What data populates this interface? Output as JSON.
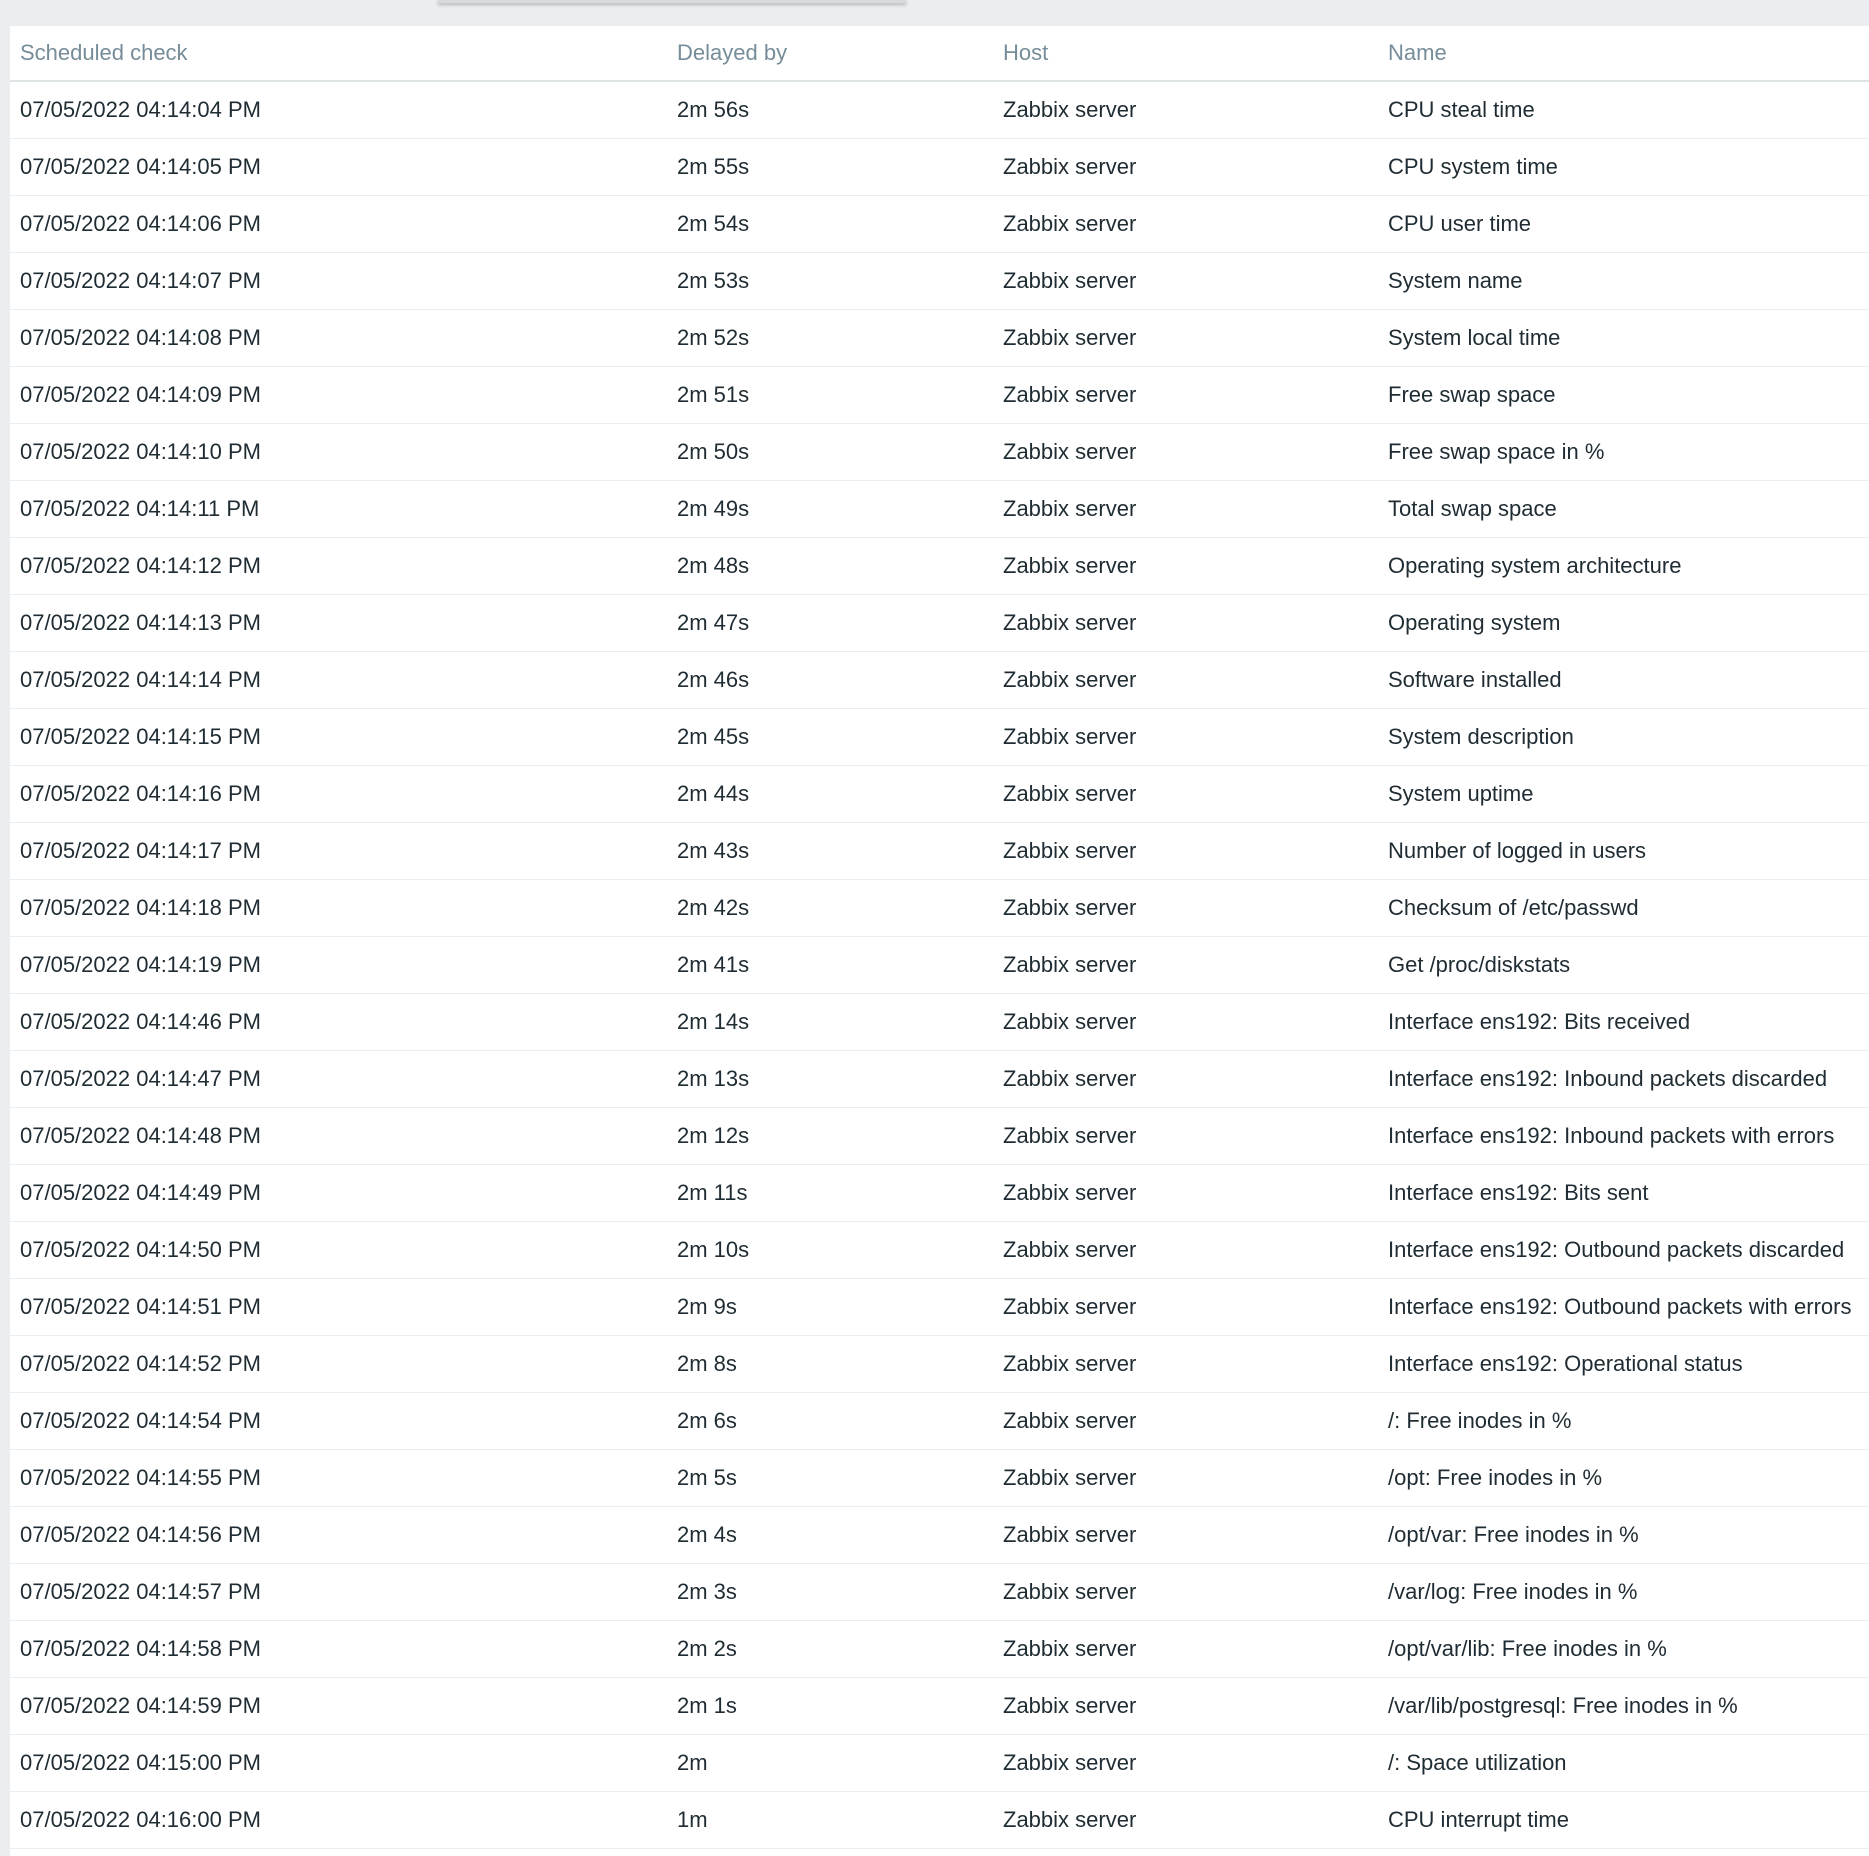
{
  "table": {
    "columns": [
      "Scheduled check",
      "Delayed by",
      "Host",
      "Name"
    ],
    "rows": [
      [
        "07/05/2022 04:14:04 PM",
        "2m 56s",
        "Zabbix server",
        "CPU steal time"
      ],
      [
        "07/05/2022 04:14:05 PM",
        "2m 55s",
        "Zabbix server",
        "CPU system time"
      ],
      [
        "07/05/2022 04:14:06 PM",
        "2m 54s",
        "Zabbix server",
        "CPU user time"
      ],
      [
        "07/05/2022 04:14:07 PM",
        "2m 53s",
        "Zabbix server",
        "System name"
      ],
      [
        "07/05/2022 04:14:08 PM",
        "2m 52s",
        "Zabbix server",
        "System local time"
      ],
      [
        "07/05/2022 04:14:09 PM",
        "2m 51s",
        "Zabbix server",
        "Free swap space"
      ],
      [
        "07/05/2022 04:14:10 PM",
        "2m 50s",
        "Zabbix server",
        "Free swap space in %"
      ],
      [
        "07/05/2022 04:14:11 PM",
        "2m 49s",
        "Zabbix server",
        "Total swap space"
      ],
      [
        "07/05/2022 04:14:12 PM",
        "2m 48s",
        "Zabbix server",
        "Operating system architecture"
      ],
      [
        "07/05/2022 04:14:13 PM",
        "2m 47s",
        "Zabbix server",
        "Operating system"
      ],
      [
        "07/05/2022 04:14:14 PM",
        "2m 46s",
        "Zabbix server",
        "Software installed"
      ],
      [
        "07/05/2022 04:14:15 PM",
        "2m 45s",
        "Zabbix server",
        "System description"
      ],
      [
        "07/05/2022 04:14:16 PM",
        "2m 44s",
        "Zabbix server",
        "System uptime"
      ],
      [
        "07/05/2022 04:14:17 PM",
        "2m 43s",
        "Zabbix server",
        "Number of logged in users"
      ],
      [
        "07/05/2022 04:14:18 PM",
        "2m 42s",
        "Zabbix server",
        "Checksum of /etc/passwd"
      ],
      [
        "07/05/2022 04:14:19 PM",
        "2m 41s",
        "Zabbix server",
        "Get /proc/diskstats"
      ],
      [
        "07/05/2022 04:14:46 PM",
        "2m 14s",
        "Zabbix server",
        "Interface ens192: Bits received"
      ],
      [
        "07/05/2022 04:14:47 PM",
        "2m 13s",
        "Zabbix server",
        "Interface ens192: Inbound packets discarded"
      ],
      [
        "07/05/2022 04:14:48 PM",
        "2m 12s",
        "Zabbix server",
        "Interface ens192: Inbound packets with errors"
      ],
      [
        "07/05/2022 04:14:49 PM",
        "2m 11s",
        "Zabbix server",
        "Interface ens192: Bits sent"
      ],
      [
        "07/05/2022 04:14:50 PM",
        "2m 10s",
        "Zabbix server",
        "Interface ens192: Outbound packets discarded"
      ],
      [
        "07/05/2022 04:14:51 PM",
        "2m 9s",
        "Zabbix server",
        "Interface ens192: Outbound packets with errors"
      ],
      [
        "07/05/2022 04:14:52 PM",
        "2m 8s",
        "Zabbix server",
        "Interface ens192: Operational status"
      ],
      [
        "07/05/2022 04:14:54 PM",
        "2m 6s",
        "Zabbix server",
        "/: Free inodes in %"
      ],
      [
        "07/05/2022 04:14:55 PM",
        "2m 5s",
        "Zabbix server",
        "/opt: Free inodes in %"
      ],
      [
        "07/05/2022 04:14:56 PM",
        "2m 4s",
        "Zabbix server",
        "/opt/var: Free inodes in %"
      ],
      [
        "07/05/2022 04:14:57 PM",
        "2m 3s",
        "Zabbix server",
        "/var/log: Free inodes in %"
      ],
      [
        "07/05/2022 04:14:58 PM",
        "2m 2s",
        "Zabbix server",
        "/opt/var/lib: Free inodes in %"
      ],
      [
        "07/05/2022 04:14:59 PM",
        "2m 1s",
        "Zabbix server",
        "/var/lib/postgresql: Free inodes in %"
      ],
      [
        "07/05/2022 04:15:00 PM",
        "2m",
        "Zabbix server",
        "/: Space utilization"
      ],
      [
        "07/05/2022 04:16:00 PM",
        "1m",
        "Zabbix server",
        "CPU interrupt time"
      ]
    ]
  }
}
